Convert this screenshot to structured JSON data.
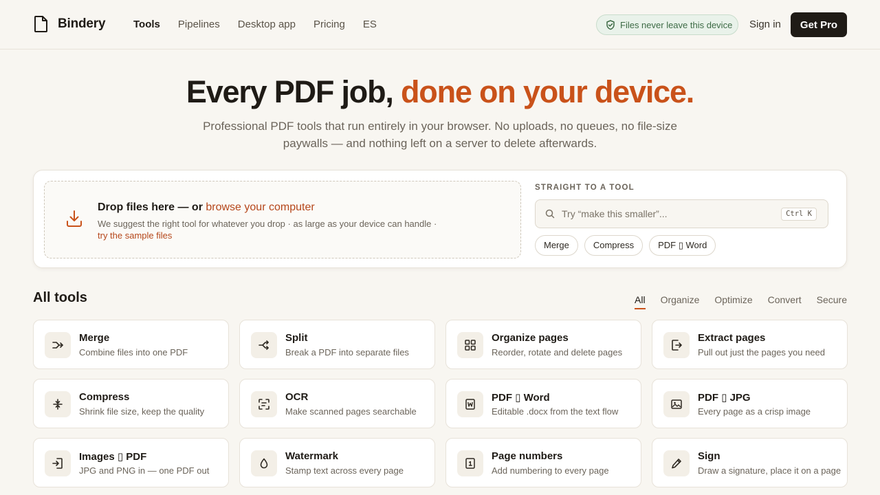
{
  "header": {
    "logo_text": "Bindery",
    "nav": [
      "Tools",
      "Pipelines",
      "Desktop app",
      "Pricing",
      "ES"
    ],
    "privacy_badge": "Files never leave this device",
    "sign_in": "Sign in",
    "get_pro": "Get Pro"
  },
  "hero": {
    "title_main": "Every PDF job,",
    "title_accent": "done on your device.",
    "subtitle": "Professional PDF tools that run entirely in your browser. No uploads, no queues, no file-size paywalls — and nothing left on a server to delete afterwards."
  },
  "upload": {
    "drop_title": "Drop files here — or",
    "browse_link": "browse your computer",
    "drop_desc": "We suggest the right tool for whatever you drop · as large as your device can handle ·",
    "sample_link": "try the sample files",
    "straight_label": "STRAIGHT TO A TOOL",
    "search_placeholder": "Try “make this smaller”...",
    "shortcut": "Ctrl K",
    "chips": [
      "Merge",
      "Compress",
      "PDF ▯ Word"
    ]
  },
  "tools": {
    "section_title": "All tools",
    "filters": [
      "All",
      "Organize",
      "Optimize",
      "Convert",
      "Secure"
    ],
    "items": [
      {
        "name": "Merge",
        "desc": "Combine files into one PDF",
        "icon": "merge-icon"
      },
      {
        "name": "Split",
        "desc": "Break a PDF into separate files",
        "icon": "split-icon"
      },
      {
        "name": "Organize pages",
        "desc": "Reorder, rotate and delete pages",
        "icon": "grid-icon"
      },
      {
        "name": "Extract pages",
        "desc": "Pull out just the pages you need",
        "icon": "extract-icon"
      },
      {
        "name": "Compress",
        "desc": "Shrink file size, keep the quality",
        "icon": "compress-icon"
      },
      {
        "name": "OCR",
        "desc": "Make scanned pages searchable",
        "icon": "scan-icon"
      },
      {
        "name": "PDF ▯ Word",
        "desc": "Editable .docx from the text flow",
        "icon": "word-icon"
      },
      {
        "name": "PDF ▯ JPG",
        "desc": "Every page as a crisp image",
        "icon": "image-icon"
      },
      {
        "name": "Images ▯ PDF",
        "desc": "JPG and PNG in — one PDF out",
        "icon": "import-icon"
      },
      {
        "name": "Watermark",
        "desc": "Stamp text across every page",
        "icon": "drop-icon"
      },
      {
        "name": "Page numbers",
        "desc": "Add numbering to every page",
        "icon": "number-icon"
      },
      {
        "name": "Sign",
        "desc": "Draw a signature, place it on a page",
        "icon": "pen-icon"
      }
    ]
  },
  "colors": {
    "accent": "#c9521a",
    "ink": "#1f1b16",
    "background": "#f8f6f1",
    "success": "#3d6b45"
  }
}
